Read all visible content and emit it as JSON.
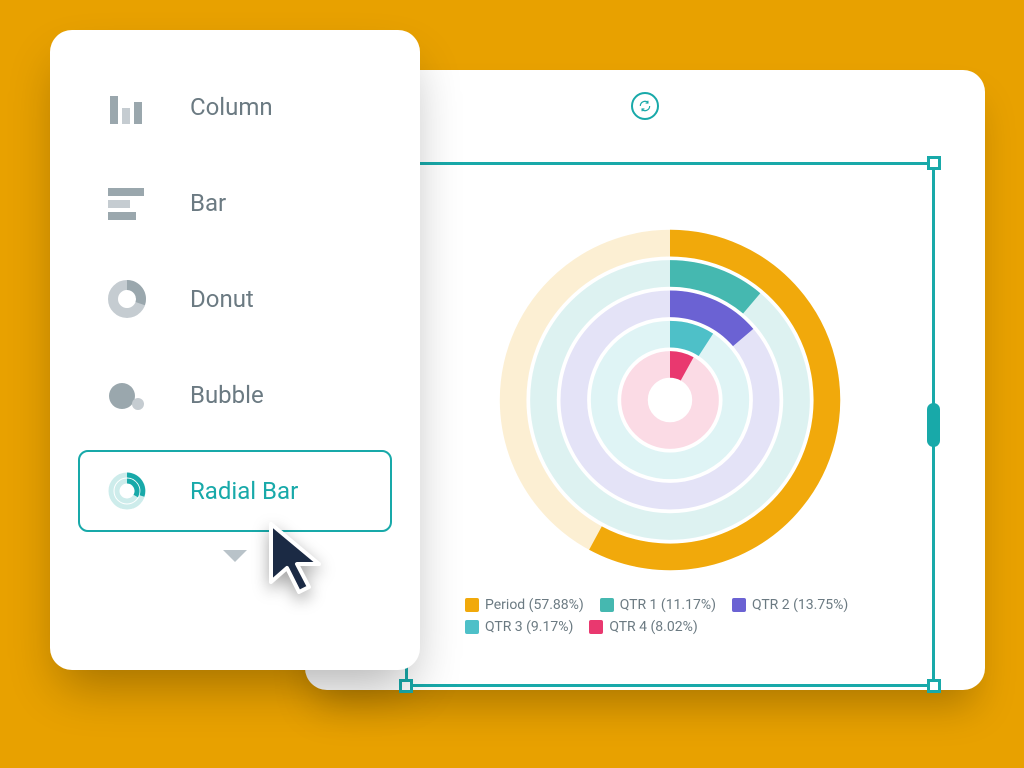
{
  "picker": {
    "options": [
      {
        "id": "column",
        "label": "Column"
      },
      {
        "id": "bar",
        "label": "Bar"
      },
      {
        "id": "donut",
        "label": "Donut"
      },
      {
        "id": "bubble",
        "label": "Bubble"
      },
      {
        "id": "radialbar",
        "label": "Radial Bar"
      }
    ],
    "selected": "radialbar"
  },
  "colors": {
    "accent": "#18a9a9",
    "grey": "#9aa7ad",
    "grey_light": "#c5ccd1"
  },
  "chart_data": {
    "type": "radialbar",
    "series": [
      {
        "name": "Period",
        "percent": 57.88,
        "color": "#f1a90b"
      },
      {
        "name": "QTR 1",
        "percent": 11.17,
        "color": "#45b8b0"
      },
      {
        "name": "QTR 2",
        "percent": 13.75,
        "color": "#6b62d3"
      },
      {
        "name": "QTR 3",
        "percent": 9.17,
        "color": "#4ec0c8"
      },
      {
        "name": "QTR 4",
        "percent": 8.02,
        "color": "#e9386f"
      }
    ],
    "track_alpha": 0.18,
    "legend_format": "{name} ({percent}%)"
  }
}
